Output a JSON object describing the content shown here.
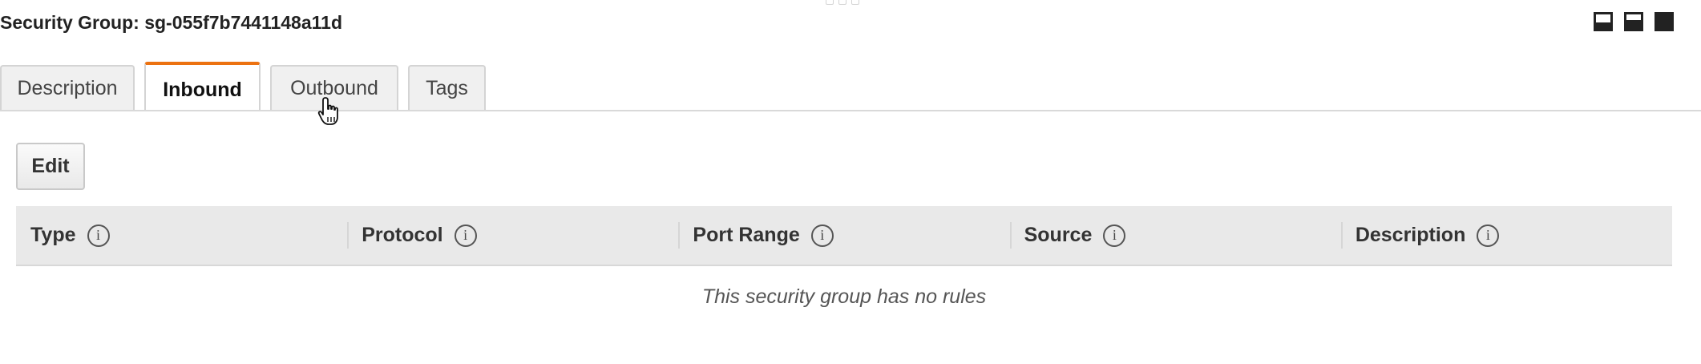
{
  "panel": {
    "title": "Security Group: sg-055f7b7441148a11d"
  },
  "layout_controls": [
    {
      "icon": "layout-bottom-small-icon"
    },
    {
      "icon": "layout-bottom-half-icon"
    },
    {
      "icon": "layout-bottom-large-icon"
    }
  ],
  "tabs": [
    {
      "label": "Description",
      "active": false
    },
    {
      "label": "Inbound",
      "active": true
    },
    {
      "label": "Outbound",
      "active": false
    },
    {
      "label": "Tags",
      "active": false
    }
  ],
  "actions": {
    "edit_label": "Edit"
  },
  "rules_table": {
    "columns": [
      "Type",
      "Protocol",
      "Port Range",
      "Source",
      "Description"
    ],
    "info_icon": "i",
    "empty_message": "This security group has no rules"
  },
  "colors": {
    "active_tab_accent": "#ec7211",
    "header_bg": "#e9e9e9"
  }
}
